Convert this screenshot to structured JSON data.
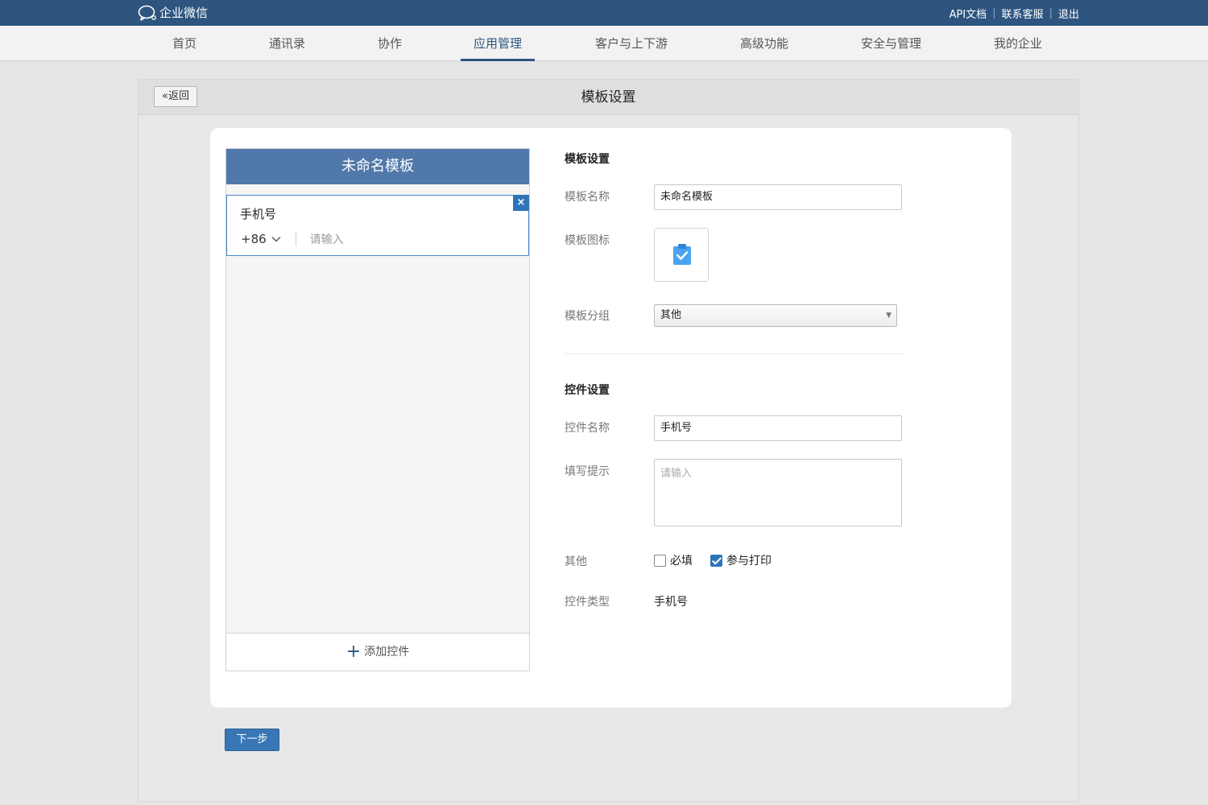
{
  "app": {
    "name": "企业微信"
  },
  "toplinks": [
    "API文档",
    "联系客服",
    "退出"
  ],
  "nav": {
    "items": [
      "首页",
      "通讯录",
      "协作",
      "应用管理",
      "客户与上下游",
      "高级功能",
      "安全与管理",
      "我的企业"
    ],
    "active_index": 3
  },
  "page": {
    "back_label": "返回",
    "title": "模板设置"
  },
  "preview": {
    "header_title": "未命名模板",
    "field": {
      "label": "手机号",
      "prefix": "+86",
      "placeholder": "请输入",
      "close": "×"
    },
    "add_control_label": "添加控件"
  },
  "template_settings": {
    "section_title": "模板设置",
    "name_label": "模板名称",
    "name_value": "未命名模板",
    "icon_label": "模板图标",
    "icon": "clipboard-check-icon",
    "group_label": "模板分组",
    "group_value": "其他"
  },
  "control_settings": {
    "section_title": "控件设置",
    "name_label": "控件名称",
    "name_value": "手机号",
    "hint_label": "填写提示",
    "hint_placeholder": "请输入",
    "other_label": "其他",
    "required_label": "必填",
    "required_checked": false,
    "print_label": "参与打印",
    "print_checked": true,
    "type_label": "控件类型",
    "type_value": "手机号"
  },
  "footer": {
    "next_label": "下一步"
  },
  "colors": {
    "brand": "#2e5580",
    "preview_header": "#5178aa",
    "accent": "#2f74b9"
  }
}
